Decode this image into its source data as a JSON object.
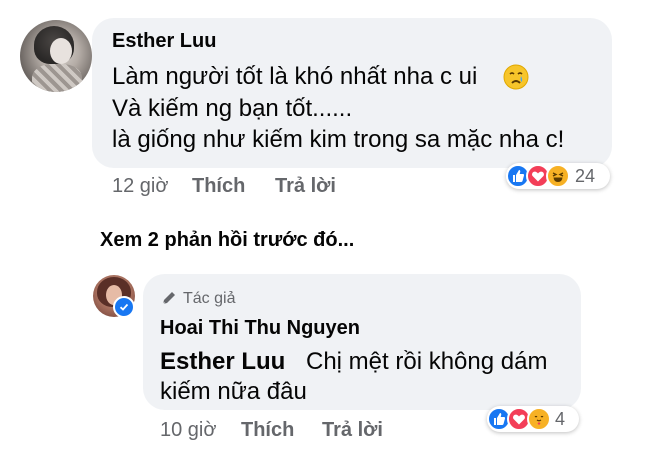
{
  "comment": {
    "author": "Esther Luu",
    "lines": [
      "Làm người tốt là khó nhất nha c ui",
      "Và kiếm ng bạn tốt......",
      "là giống như kiếm kim trong sa mặc nha c!"
    ],
    "emoji": "crying-face-icon",
    "time": "12 giờ",
    "like_label": "Thích",
    "reply_label": "Trả lời",
    "reactions": [
      "like-icon",
      "love-icon",
      "haha-icon"
    ],
    "reaction_count": "24"
  },
  "see_previous": "Xem 2 phản hồi trước đó...",
  "reply": {
    "badge": "Tác giả",
    "author": "Hoai Thi Thu Nguyen",
    "mention": "Esther Luu",
    "line1": "Chị mệt rồi không dám",
    "line2": "kiếm nữa đâu",
    "time": "10 giờ",
    "like_label": "Thích",
    "reply_label": "Trả lời",
    "reactions": [
      "like-icon",
      "love-icon",
      "care-icon"
    ],
    "reaction_count": "4"
  },
  "colors": {
    "bubble": "#f0f2f5",
    "meta_text": "#65676b",
    "like_blue": "#1877f2",
    "love_red": "#f33e58",
    "haha_yellow": "#f7b125"
  }
}
